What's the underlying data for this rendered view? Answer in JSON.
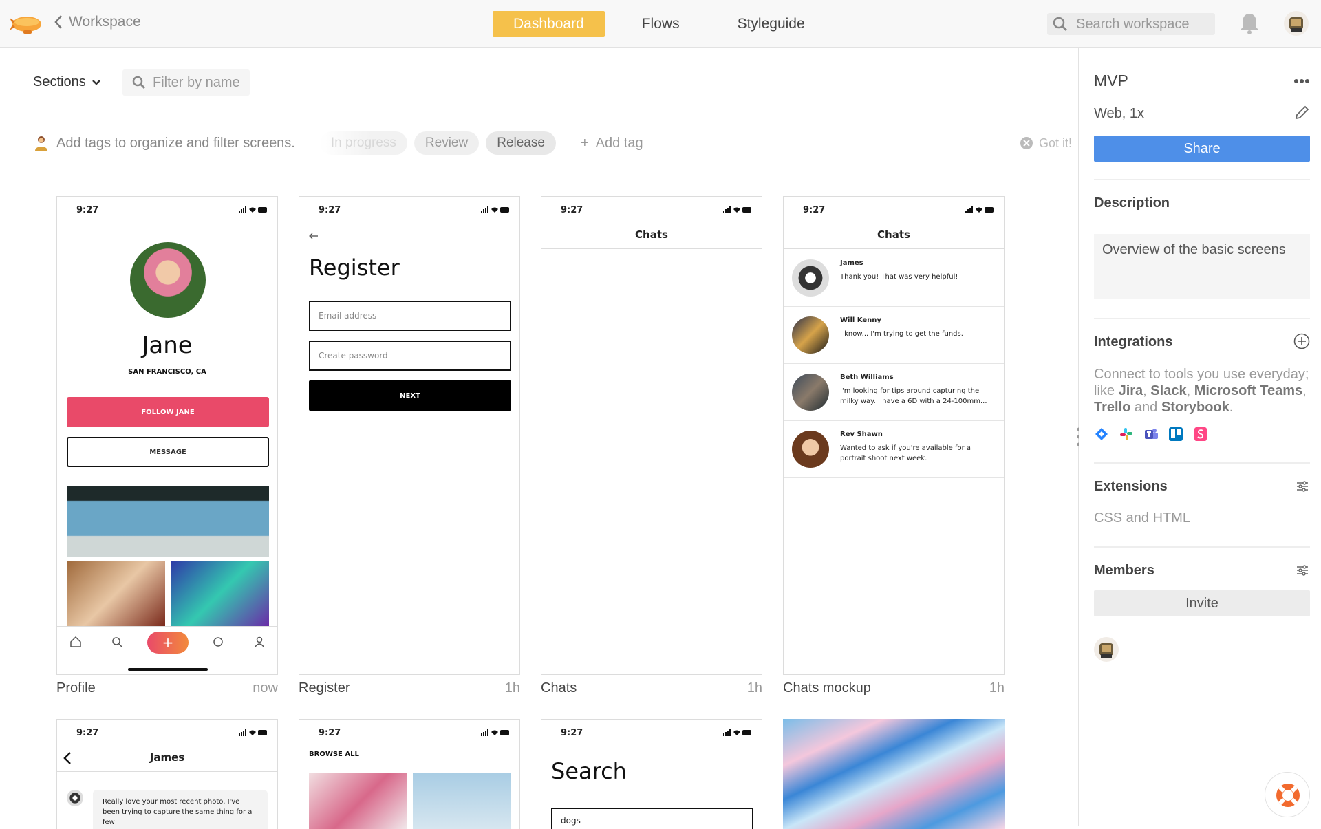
{
  "topbar": {
    "back_label": "Workspace",
    "tabs": [
      {
        "label": "Dashboard",
        "active": true
      },
      {
        "label": "Flows",
        "active": false
      },
      {
        "label": "Styleguide",
        "active": false
      }
    ],
    "search_placeholder": "Search workspace",
    "icons": [
      "zeppelin-logo-icon",
      "chevron-left-icon",
      "search-icon",
      "bell-icon",
      "user-avatar-icon"
    ]
  },
  "toolbar": {
    "sections_label": "Sections",
    "filter_placeholder": "Filter by name"
  },
  "tags": {
    "hint": "Add tags to organize and filter screens.",
    "items": [
      "In progress",
      "Review",
      "Release"
    ],
    "add_label": "Add tag",
    "dismiss_label": "Got it!"
  },
  "screens": [
    {
      "title": "Profile",
      "time": "now",
      "status_time": "9:27",
      "name": "Jane",
      "location": "SAN FRANCISCO, CA",
      "primary": "FOLLOW JANE",
      "secondary": "MESSAGE"
    },
    {
      "title": "Register",
      "time": "1h",
      "status_time": "9:27",
      "heading": "Register",
      "email": "Email address",
      "password": "Create password",
      "button": "NEXT"
    },
    {
      "title": "Chats",
      "time": "1h",
      "status_time": "9:27",
      "header": "Chats"
    },
    {
      "title": "Chats mockup",
      "time": "1h",
      "status_time": "9:27",
      "header": "Chats",
      "messages": [
        {
          "name": "James",
          "text": "Thank you! That was very helpful!"
        },
        {
          "name": "Will Kenny",
          "text": "I know... I'm trying to get the funds."
        },
        {
          "name": "Beth Williams",
          "text": "I'm looking for tips around capturing the milky way. I have a 6D with a 24-100mm..."
        },
        {
          "name": "Rev Shawn",
          "text": "Wanted to ask if you're available for a portrait shoot next week."
        }
      ]
    }
  ],
  "screens_row2": [
    {
      "status_time": "9:27",
      "header": "James",
      "message": "Really love your most recent photo. I've been trying to capture the same thing for a few"
    },
    {
      "status_time": "9:27",
      "header": "BROWSE ALL"
    },
    {
      "status_time": "9:27",
      "heading": "Search",
      "input": "dogs"
    },
    {
      "kind": "image"
    }
  ],
  "sidebar": {
    "title": "MVP",
    "subtitle": "Web, 1x",
    "share_label": "Share",
    "description_label": "Description",
    "description": "Overview of the basic screens",
    "integrations_label": "Integrations",
    "integrations_text_1": "Connect to tools you use everyday; like ",
    "integrations_jira": "Jira",
    "integrations_slack": "Slack",
    "integrations_teams": "Microsoft Teams",
    "integrations_trello": "Trello",
    "integrations_and": "and",
    "integrations_storybook": "Storybook",
    "integration_icons": [
      "jira-icon",
      "slack-icon",
      "microsoft-teams-icon",
      "trello-icon",
      "storybook-icon"
    ],
    "extensions_label": "Extensions",
    "extensions_value": "CSS and HTML",
    "members_label": "Members",
    "invite_label": "Invite"
  },
  "colors": {
    "accent": "#f5c14b",
    "share": "#4e8fe8",
    "follow": "#e94a69"
  }
}
